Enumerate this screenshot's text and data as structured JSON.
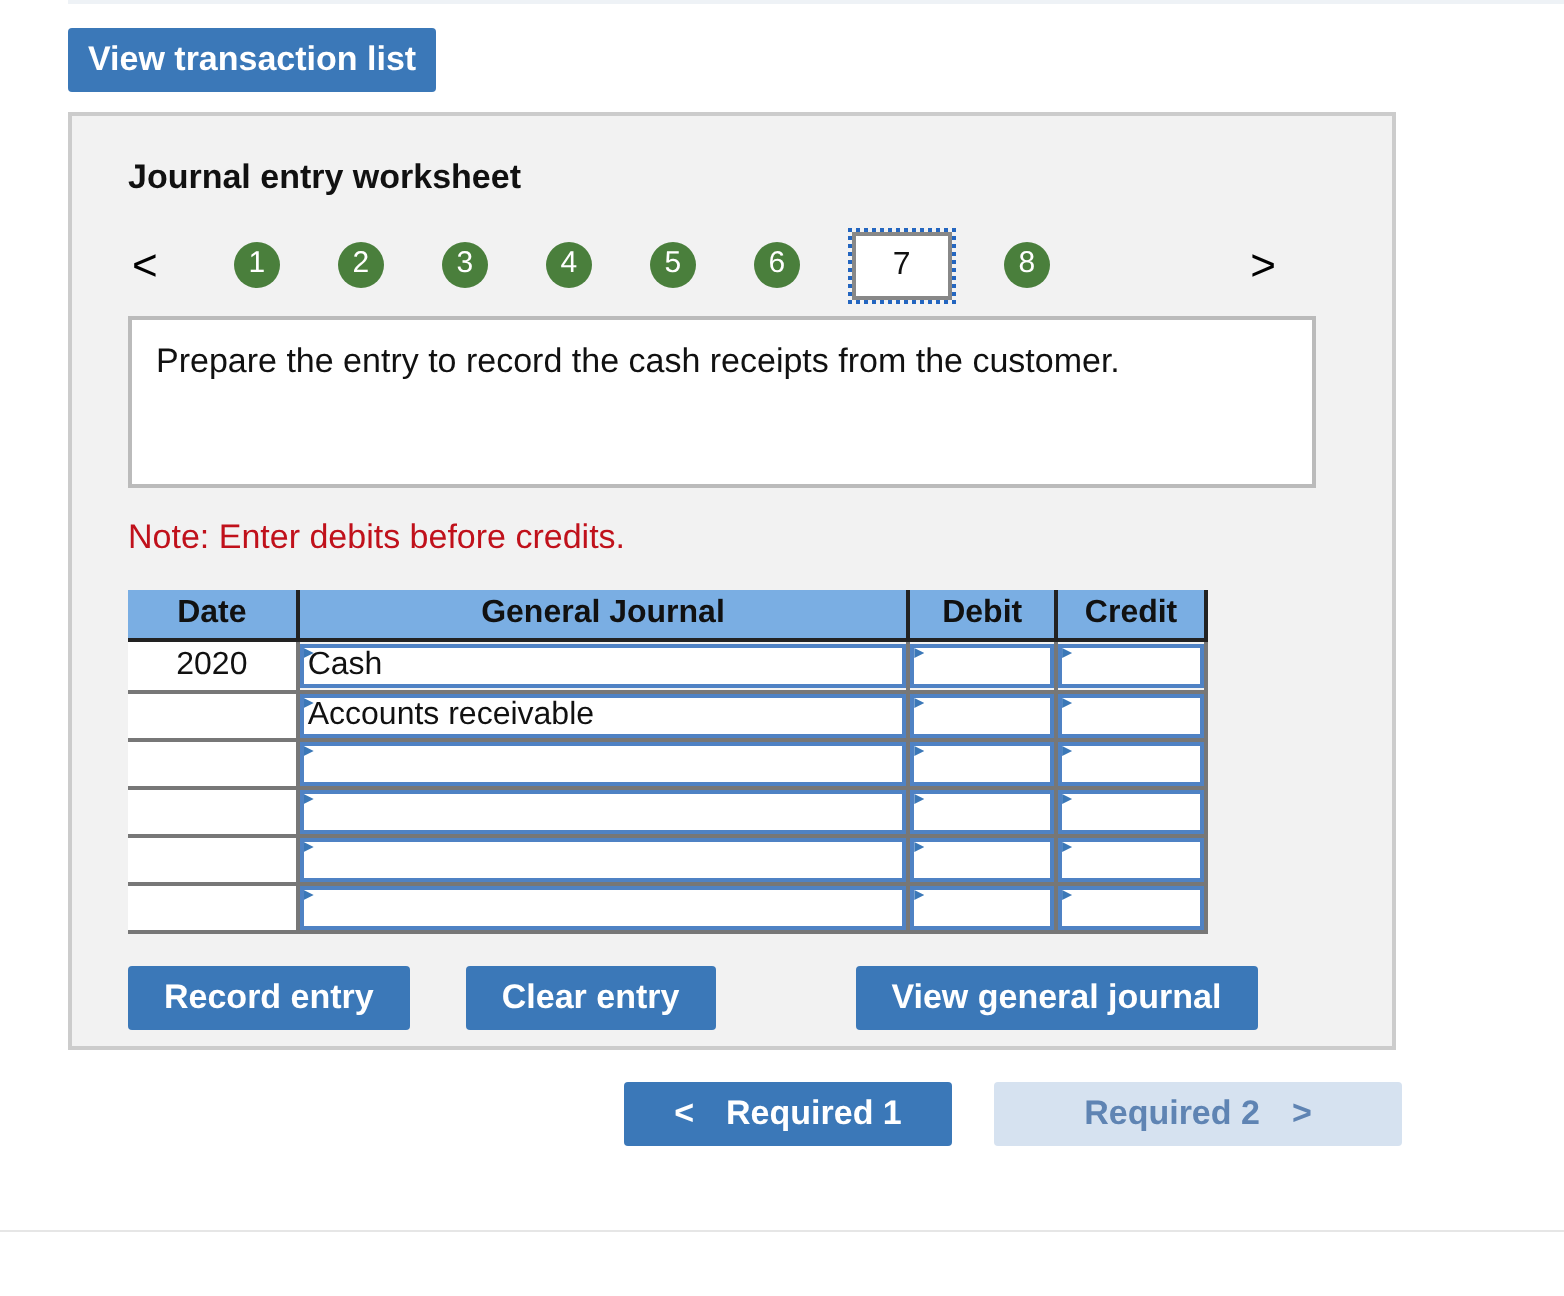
{
  "top_button": "View transaction list",
  "worksheet": {
    "title": "Journal entry worksheet",
    "prev": "<",
    "next": ">",
    "steps": [
      {
        "label": "1",
        "selected": false
      },
      {
        "label": "2",
        "selected": false
      },
      {
        "label": "3",
        "selected": false
      },
      {
        "label": "4",
        "selected": false
      },
      {
        "label": "5",
        "selected": false
      },
      {
        "label": "6",
        "selected": false
      },
      {
        "label": "7",
        "selected": true
      },
      {
        "label": "8",
        "selected": false
      }
    ],
    "instruction": "Prepare the entry to record the cash receipts from the customer.",
    "note": "Note: Enter debits before credits.",
    "table": {
      "columns": [
        "Date",
        "General Journal",
        "Debit",
        "Credit"
      ],
      "rows": [
        {
          "date": "2020",
          "account": "Cash"
        },
        {
          "account": "Accounts receivable"
        },
        {},
        {},
        {},
        {}
      ]
    },
    "buttons": [
      "Record entry",
      "Clear entry",
      "View general journal"
    ]
  },
  "nav": [
    {
      "label": "Required 1",
      "arrow": "<",
      "disabled": false
    },
    {
      "label": "Required 2",
      "arrow": ">",
      "disabled": true
    }
  ]
}
